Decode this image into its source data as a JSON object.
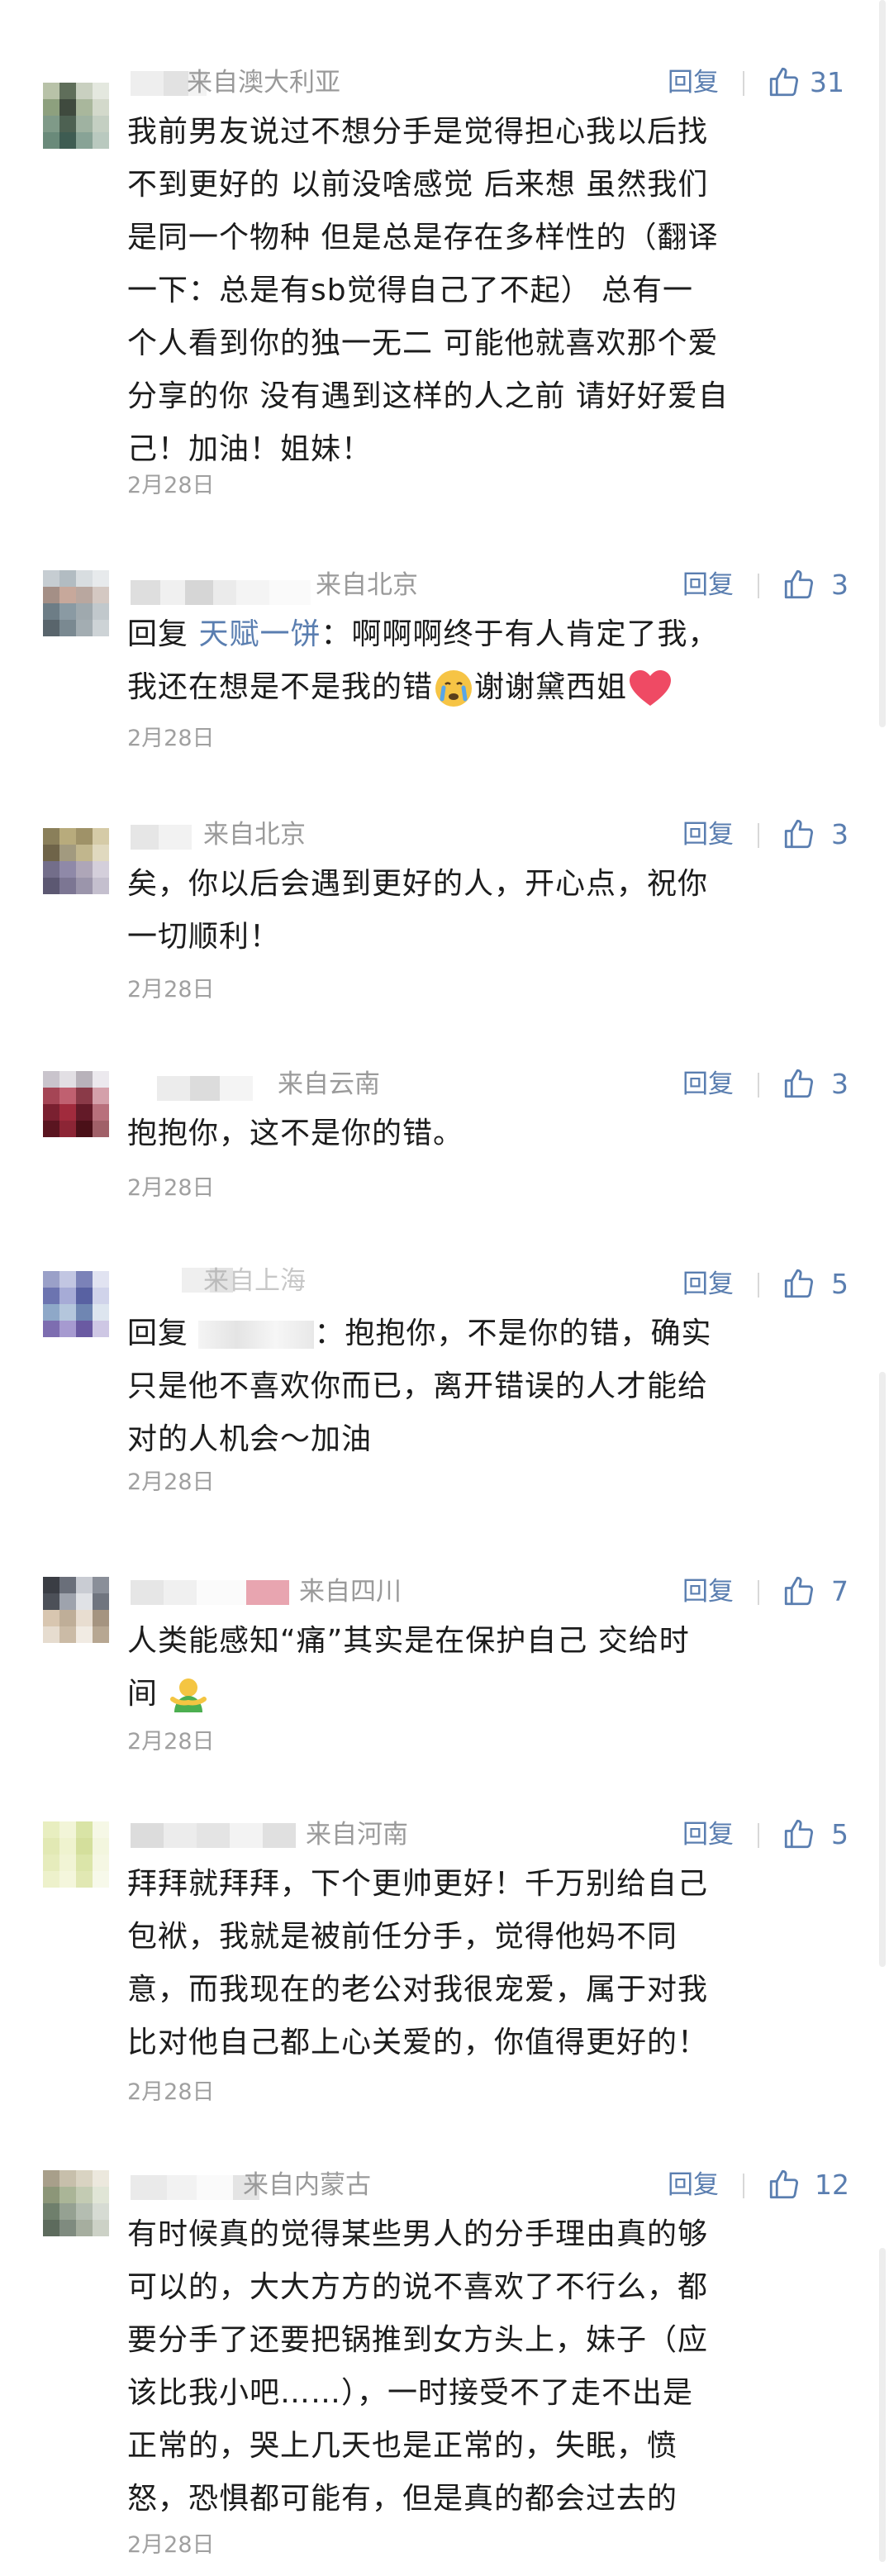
{
  "comments": [
    {
      "location": "来自澳大利亚",
      "reply_label": "回复",
      "likes": "31",
      "lines": [
        "我前男友说过不想分手是觉得担心我以后找",
        "不到更好的  以前没啥感觉 后来想 虽然我们",
        "是同一个物种 但是总是存在多样性的（翻译",
        "一下：总是有sb觉得自己了不起）   总有一",
        "个人看到你的独一无二 可能他就喜欢那个爱",
        "分享的你 没有遇到这样的人之前 请好好爱自",
        "己！加油！姐妹！"
      ],
      "date": "2月28日"
    },
    {
      "location": "来自北京",
      "reply_label": "回复",
      "likes": "3",
      "reply_prefix": "回复 ",
      "reply_to": "天赋一饼",
      "line1_rest": "：啊啊啊终于有人肯定了我，",
      "line2": "我还在想是不是我的错",
      "line2b": "谢谢黛西姐",
      "date": "2月28日"
    },
    {
      "location": "来自北京",
      "reply_label": "回复",
      "likes": "3",
      "lines": [
        "矣，你以后会遇到更好的人，开心点，祝你",
        "一切顺利！"
      ],
      "date": "2月28日"
    },
    {
      "location": "来自云南",
      "reply_label": "回复",
      "likes": "3",
      "lines": [
        "抱抱你，这不是你的错。"
      ],
      "date": "2月28日"
    },
    {
      "location": "来自上海",
      "reply_label": "回复",
      "likes": "5",
      "reply_prefix": "回复 ",
      "line1_rest": "：抱抱你，不是你的错，确实",
      "lines": [
        "只是他不喜欢你而已，离开错误的人才能给",
        "对的人机会～加油"
      ],
      "date": "2月28日"
    },
    {
      "location": "来自四川",
      "reply_label": "回复",
      "likes": "7",
      "lines": [
        "人类能感知“痛”其实是在保护自己 交给时"
      ],
      "line2": "间 ",
      "date": "2月28日"
    },
    {
      "location": "来自河南",
      "reply_label": "回复",
      "likes": "5",
      "lines": [
        "拜拜就拜拜，下个更帅更好！千万别给自己",
        "包袱，我就是被前任分手，觉得他妈不同",
        "意，而我现在的老公对我很宠爱，属于对我",
        "比对他自己都上心关爱的，你值得更好的！"
      ],
      "date": "2月28日"
    },
    {
      "location": "来自内蒙古",
      "reply_label": "回复",
      "likes": "12",
      "lines": [
        "有时候真的觉得某些男人的分手理由真的够",
        "可以的，大大方方的说不喜欢了不行么，都",
        "要分手了还要把锅推到女方头上，妹子（应",
        "该比我小吧……），一时接受不了走不出是",
        "正常的，哭上几天也是正常的，失眠，愤",
        "怒，恐惧都可能有，但是真的都会过去的"
      ],
      "date": "2月28日"
    }
  ],
  "colors": {
    "link": "#5a7eb0",
    "meta": "#9a9a9a",
    "date": "#a0a0a0",
    "text": "#1c1c1c"
  },
  "icons": {
    "like": "thumbs-up-outline-icon",
    "crying": "crying-face-icon",
    "heart": "red-heart-icon",
    "hug": "hugging-person-icon"
  }
}
